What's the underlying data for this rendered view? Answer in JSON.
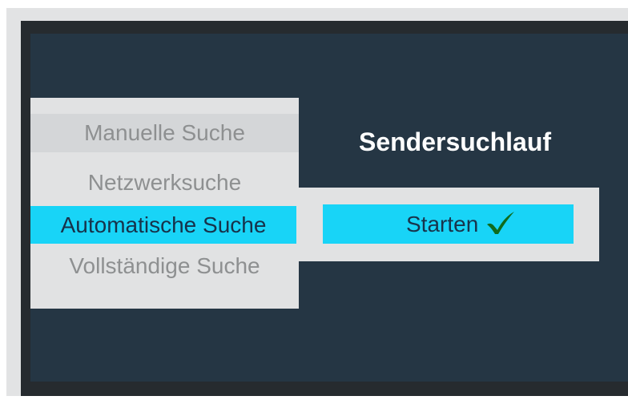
{
  "screen": {
    "title": "Sendersuchlauf"
  },
  "menu": {
    "items": [
      {
        "label": "Manuelle Suche",
        "state": "hovered"
      },
      {
        "label": "Netzwerksuche",
        "state": "normal"
      },
      {
        "label": "Automatische Suche",
        "state": "selected"
      },
      {
        "label": "Vollständige Suche",
        "state": "normal"
      }
    ]
  },
  "action": {
    "label": "Starten",
    "icon": "checkmark-icon"
  },
  "colors": {
    "screen_background": "#253644",
    "highlight": "#18d4f7",
    "panel": "#e1e2e3",
    "checkmark": "#0f6b1c"
  }
}
